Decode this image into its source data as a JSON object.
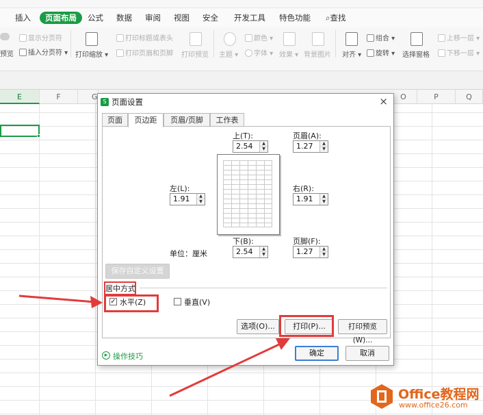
{
  "ribbon": {
    "tabs": [
      "插入",
      "页面布局",
      "公式",
      "数据",
      "审阅",
      "视图",
      "安全",
      "开发工具",
      "特色功能",
      "查找"
    ],
    "active_tab": "页面布局",
    "tools": {
      "show_page_breaks": "显示分页符",
      "insert_page_break": "插入分页符",
      "preview": "预览",
      "print_scale": "打印缩放",
      "print_titles": "打印标题或表头",
      "print_header_footer": "打印页眉和页脚",
      "print_preview": "打印预览",
      "theme": "主题",
      "colors": "颜色",
      "fonts": "字体",
      "effects": "效果",
      "background": "背景图片",
      "align": "对齐",
      "group": "组合",
      "rotate": "旋转",
      "selection_pane": "选择窗格",
      "bring_forward": "上移一层",
      "send_backward": "下移一层"
    }
  },
  "sheet": {
    "columns": [
      "E",
      "F",
      "G",
      "O",
      "P",
      "Q"
    ],
    "selected_column": "E"
  },
  "dialog": {
    "title": "页面设置",
    "close": "×",
    "tabs": [
      "页面",
      "页边距",
      "页眉/页脚",
      "工作表"
    ],
    "active_tab": "页边距",
    "margins": {
      "top_label": "上(T):",
      "top_value": "2.54",
      "header_label": "页眉(A):",
      "header_value": "1.27",
      "left_label": "左(L):",
      "left_value": "1.91",
      "right_label": "右(R):",
      "right_value": "1.91",
      "bottom_label": "下(B):",
      "bottom_value": "2.54",
      "footer_label": "页脚(F):",
      "footer_value": "1.27",
      "unit_label": "单位：厘米"
    },
    "save_custom": "保存自定义设置(S)",
    "center_section_label": "居中方式",
    "horizontal_label": "水平(Z)",
    "horizontal_checked": true,
    "vertical_label": "垂直(V)",
    "vertical_checked": false,
    "buttons": {
      "options": "选项(O)...",
      "print": "打印(P)...",
      "print_preview": "打印预览(W)...",
      "ok": "确定",
      "cancel": "取消"
    },
    "tips": "操作技巧"
  },
  "watermark": {
    "line1": "Office教程网",
    "line2": "www.office26.com"
  },
  "colors": {
    "accent_green": "#1a9b45",
    "highlight_red": "#e23b3b",
    "watermark_orange": "#e2661b"
  }
}
